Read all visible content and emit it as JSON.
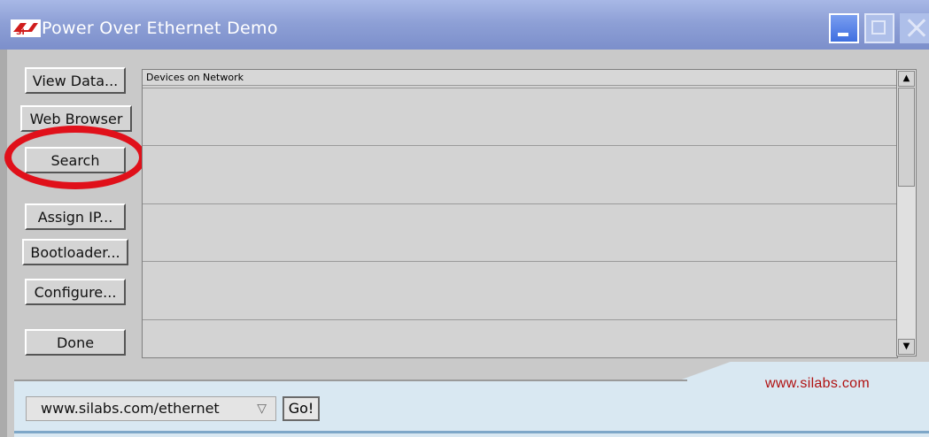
{
  "window": {
    "title": "Power Over Ethernet Demo",
    "logo_text": "SI",
    "controls": [
      "minimize",
      "maximize",
      "close"
    ]
  },
  "sidebar": {
    "buttons": [
      {
        "id": "view-data",
        "label": "View Data..."
      },
      {
        "id": "web-browser",
        "label": "Web Browser"
      },
      {
        "id": "search",
        "label": "Search",
        "highlighted": true
      },
      {
        "id": "assign-ip",
        "label": "Assign IP..."
      },
      {
        "id": "bootloader",
        "label": "Bootloader..."
      },
      {
        "id": "configure",
        "label": "Configure..."
      },
      {
        "id": "done",
        "label": "Done"
      }
    ]
  },
  "device_list": {
    "header": "Devices on Network",
    "rows": [
      "",
      "",
      "",
      "",
      ""
    ]
  },
  "footer": {
    "brand_url": "www.silabs.com",
    "url_dropdown": {
      "selected": "www.silabs.com/ethernet"
    },
    "go_label": "Go!"
  },
  "colors": {
    "titlebar": "#8ea0d6",
    "highlight_ring": "#e0101a",
    "brand_text": "#b01010",
    "footer_bg": "#d9e8f2"
  }
}
